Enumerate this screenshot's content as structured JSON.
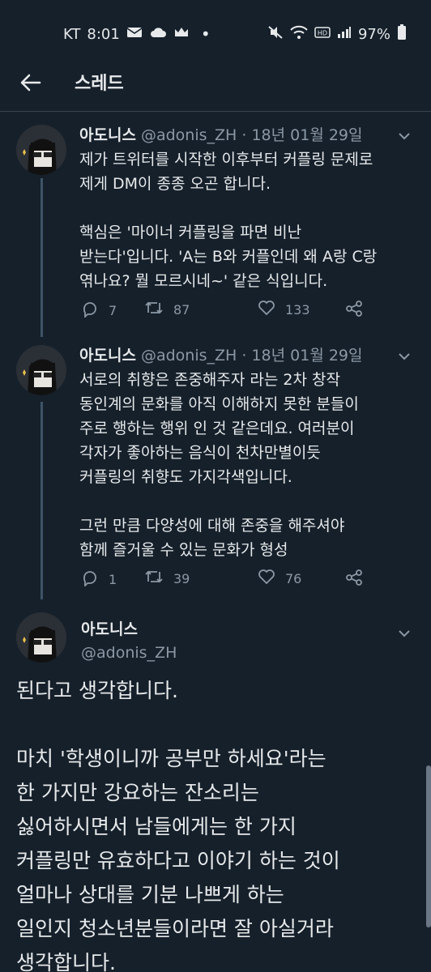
{
  "status_bar": {
    "carrier": "KT",
    "time": "8:01",
    "battery": "97%"
  },
  "header": {
    "title": "스레드"
  },
  "tweets": [
    {
      "name": "아도니스",
      "handle": "@adonis_ZH",
      "date": "· 18년 01월 29일",
      "lines": [
        "제가 트위터를 시작한 이후부터 커플링 문제로",
        "제게 DM이 종종 오곤 합니다.",
        "",
        "핵심은 '마이너 커플링을 파면 비난",
        "받는다'입니다. 'A는 B와 커플인데 왜 A랑 C랑",
        "엮나요? 뭘 모르시네~' 같은 식입니다."
      ],
      "replies": "7",
      "retweets": "87",
      "likes": "133"
    },
    {
      "name": "아도니스",
      "handle": "@adonis_ZH",
      "date": "· 18년 01월 29일",
      "lines": [
        "서로의 취향은 존중해주자 라는 2차 창작",
        "동인계의 문화를 아직 이해하지 못한 분들이",
        "주로 행하는 행위 인 것 같은데요. 여러분이",
        "각자가 좋아하는 음식이 천차만별이듯",
        "커플링의 취향도 가지각색입니다.",
        "",
        "그런 만큼 다양성에 대해 존중을 해주셔야",
        "함께 즐거울 수 있는 문화가 형성"
      ],
      "replies": "1",
      "retweets": "39",
      "likes": "76"
    }
  ],
  "main_tweet": {
    "name": "아도니스",
    "handle": "@adonis_ZH",
    "lines": [
      "된다고 생각합니다.",
      "",
      "마치 '학생이니까 공부만 하세요'라는",
      "한 가지만 강요하는 잔소리는",
      "싫어하시면서 남들에게는 한 가지",
      "커플링만 유효하다고 이야기 하는 것이",
      "얼마나 상대를 기분 나쁘게 하는",
      "일인지 청소년분들이라면 잘 아실거라",
      "생각합니다."
    ]
  },
  "icons": {
    "back": "back-arrow-icon",
    "more": "chevron-down-icon",
    "reply": "reply-icon",
    "retweet": "retweet-icon",
    "like": "heart-icon",
    "share": "share-icon"
  },
  "colors": {
    "background": "#15202b",
    "text": "#e7e9ea",
    "secondary": "#8b98a5",
    "divider": "#38444d",
    "thread_line": "#3d5466"
  }
}
